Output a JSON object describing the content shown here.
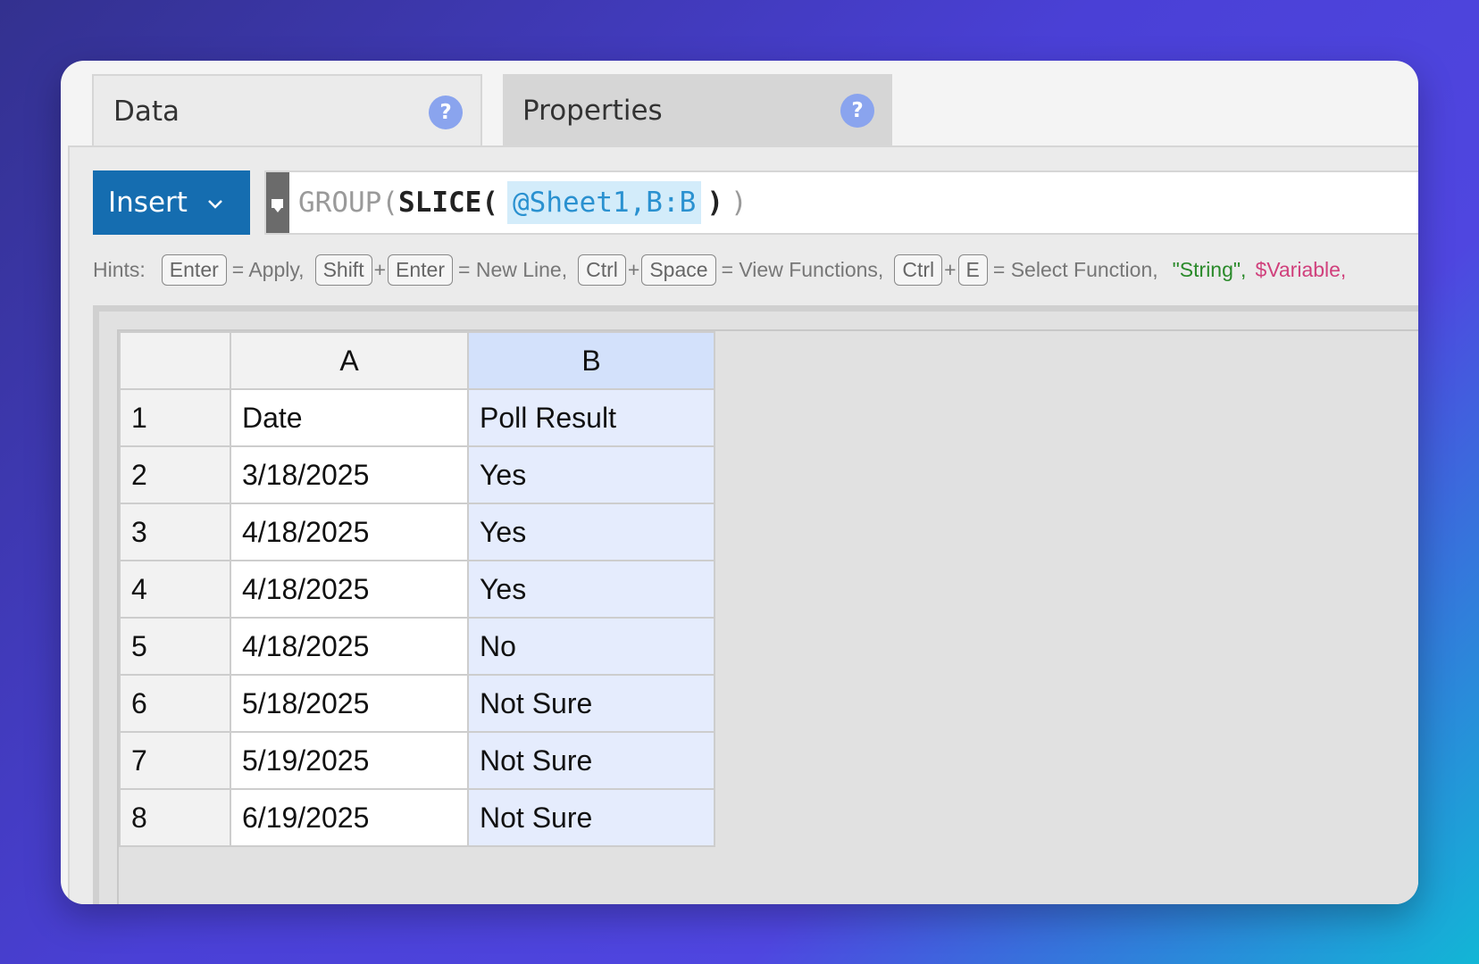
{
  "tabs": {
    "data_label": "Data",
    "properties_label": "Properties",
    "help_glyph": "?"
  },
  "toolbar": {
    "insert_label": "Insert"
  },
  "formula": {
    "group_func": "GROUP",
    "open_paren_1": "(",
    "slice_func": "SLICE",
    "open_paren_2": "(",
    "reference": "@Sheet1,B:B",
    "close_paren_1": ")",
    "close_paren_2": ")"
  },
  "hints": {
    "prefix": "Hints:",
    "enter_key": "Enter",
    "apply_text": "= Apply,",
    "shift_key": "Shift",
    "plus": "+",
    "enter_key_2": "Enter",
    "newline_text": "= New Line,",
    "ctrl_key": "Ctrl",
    "space_key": "Space",
    "view_functions_text": "= View Functions,",
    "ctrl_key_2": "Ctrl",
    "e_key": "E",
    "select_function_text": "= Select Function,",
    "string_example": "\"String\",",
    "variable_example": "$Variable,"
  },
  "sheet": {
    "columns": [
      "A",
      "B"
    ],
    "rows": [
      {
        "num": "1",
        "a": "Date",
        "b": "Poll Result"
      },
      {
        "num": "2",
        "a": "3/18/2025",
        "b": "Yes"
      },
      {
        "num": "3",
        "a": "4/18/2025",
        "b": "Yes"
      },
      {
        "num": "4",
        "a": "4/18/2025",
        "b": "Yes"
      },
      {
        "num": "5",
        "a": "4/18/2025",
        "b": "No"
      },
      {
        "num": "6",
        "a": "5/18/2025",
        "b": "Not Sure"
      },
      {
        "num": "7",
        "a": "5/19/2025",
        "b": "Not Sure"
      },
      {
        "num": "8",
        "a": "6/19/2025",
        "b": "Not Sure"
      }
    ]
  },
  "colors": {
    "insert_button": "#156db0",
    "reference_highlight": "#d3ecfa",
    "reference_text": "#2a91d0",
    "string_hint": "#2a8a2a",
    "variable_hint": "#d0407c",
    "selected_column": "#e5ecfd"
  },
  "icons": {
    "help": "help-icon",
    "dropdown": "chevron-down-icon",
    "formula_handle": "comment-icon"
  }
}
